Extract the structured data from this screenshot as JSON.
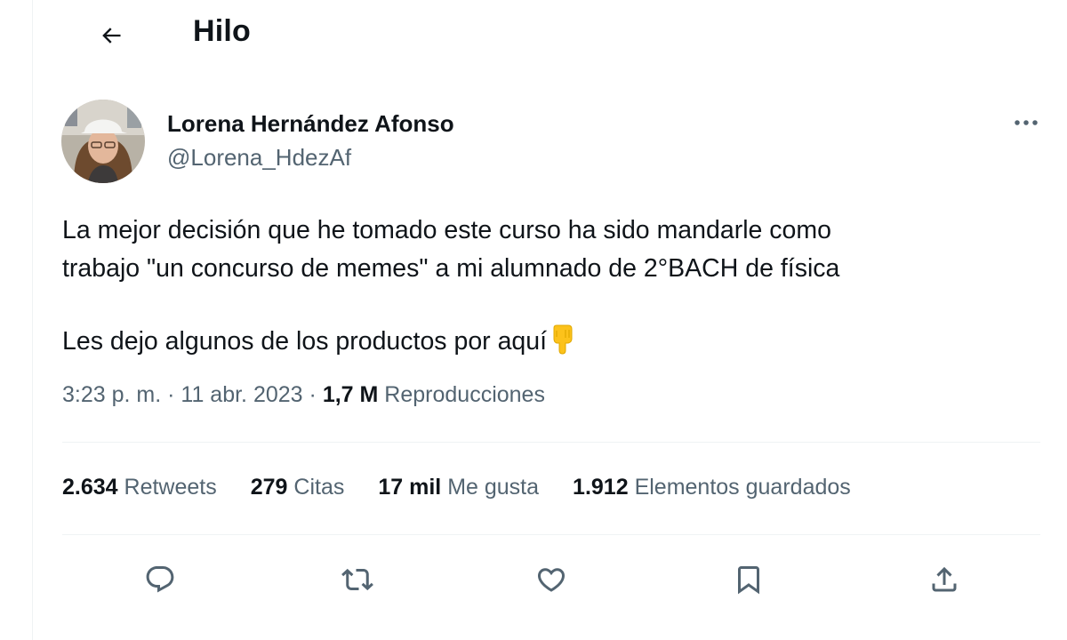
{
  "header": {
    "title": "Hilo"
  },
  "tweet": {
    "author": {
      "display_name": "Lorena Hernández Afonso",
      "handle": "@Lorena_HdezAf"
    },
    "text_lines": [
      "La mejor decisión que he tomado este curso ha sido mandarle como",
      "trabajo \"un concurso de memes\" a mi alumnado de 2°BACH de física"
    ],
    "text_line3": "Les dejo algunos de los productos por aquí",
    "emoji": "backhand-index-pointing-down",
    "time": "3:23 p. m.",
    "date": "11 abr. 2023",
    "views_count": "1,7 M",
    "views_label": "Reproducciones",
    "separator": "·"
  },
  "stats": {
    "retweets_count": "2.634",
    "retweets_label": "Retweets",
    "quotes_count": "279",
    "quotes_label": "Citas",
    "likes_count": "17 mil",
    "likes_label": "Me gusta",
    "bookmarks_count": "1.912",
    "bookmarks_label": "Elementos guardados"
  },
  "actions": [
    "reply-icon",
    "retweet-icon",
    "like-icon",
    "bookmark-icon",
    "share-icon"
  ],
  "colors": {
    "text": "#0f1419",
    "secondary": "#536471",
    "divider": "#eff3f4"
  }
}
